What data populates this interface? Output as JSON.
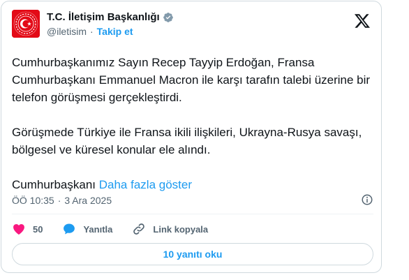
{
  "account": {
    "display_name": "T.C. İletişim Başkanlığı",
    "handle": "@iletisim",
    "separator": "·",
    "follow_label": "Takip et"
  },
  "tweet": {
    "paragraphs": [
      "Cumhurbaşkanımız Sayın Recep Tayyip Erdoğan, Fransa Cumhurbaşkanı Emmanuel Macron ile karşı tarafın talebi üzerine bir telefon görüşmesi gerçekleştirdi.",
      "Görüşmede Türkiye ile Fransa ikili ilişkileri, Ukrayna-Rusya savaşı, bölgesel ve küresel konular ele alındı."
    ],
    "truncated_text": "Cumhurbaşkanı",
    "show_more_label": "Daha fazla göster",
    "time": "ÖÖ 10:35",
    "separator": "·",
    "date": "3 Ara 2025"
  },
  "actions": {
    "like_count": "50",
    "reply_label": "Yanıtla",
    "copy_link_label": "Link kopyala"
  },
  "replies_button_label": "10 yanıtı oku",
  "colors": {
    "accent": "#1d9bf0",
    "like": "#f91880",
    "avatar_red": "#e30a17",
    "secondary_text": "#536471"
  },
  "icons": [
    "verified-badge-icon",
    "x-logo-icon",
    "info-icon",
    "heart-icon",
    "reply-bubble-icon",
    "link-icon",
    "crescent-star-logo"
  ]
}
